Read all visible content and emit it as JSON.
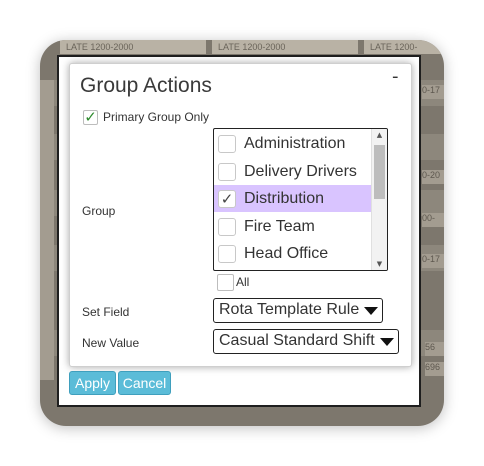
{
  "background": {
    "header_cells": [
      "LATE 1200-2000",
      "LATE 1200-2000",
      "LATE 1200-"
    ],
    "side_cells": [
      "0-17",
      "0-20",
      "00-",
      "0-17",
      "56",
      "696"
    ]
  },
  "dialog": {
    "title": "Group Actions",
    "minimize_label": "-",
    "primary_group_only": {
      "label": "Primary Group Only",
      "checked": true,
      "check_glyph": "✓"
    },
    "group": {
      "label": "Group",
      "options": [
        {
          "label": "Administration",
          "checked": false,
          "selected": false,
          "check_glyph": ""
        },
        {
          "label": "Delivery Drivers",
          "checked": false,
          "selected": false,
          "check_glyph": ""
        },
        {
          "label": "Distribution",
          "checked": true,
          "selected": true,
          "check_glyph": "✓"
        },
        {
          "label": "Fire Team",
          "checked": false,
          "selected": false,
          "check_glyph": ""
        },
        {
          "label": "Head Office",
          "checked": false,
          "selected": false,
          "check_glyph": ""
        }
      ],
      "all_label": "All"
    },
    "set_field": {
      "label": "Set Field",
      "value": "Rota Template Rule"
    },
    "new_value": {
      "label": "New Value",
      "value": "Casual Standard Shift"
    }
  },
  "actions": {
    "apply_label": "Apply",
    "cancel_label": "Cancel"
  },
  "colors": {
    "selected_row": "#d9c4ff",
    "button": "#5bbcd8",
    "check": "#2e8b2e"
  }
}
